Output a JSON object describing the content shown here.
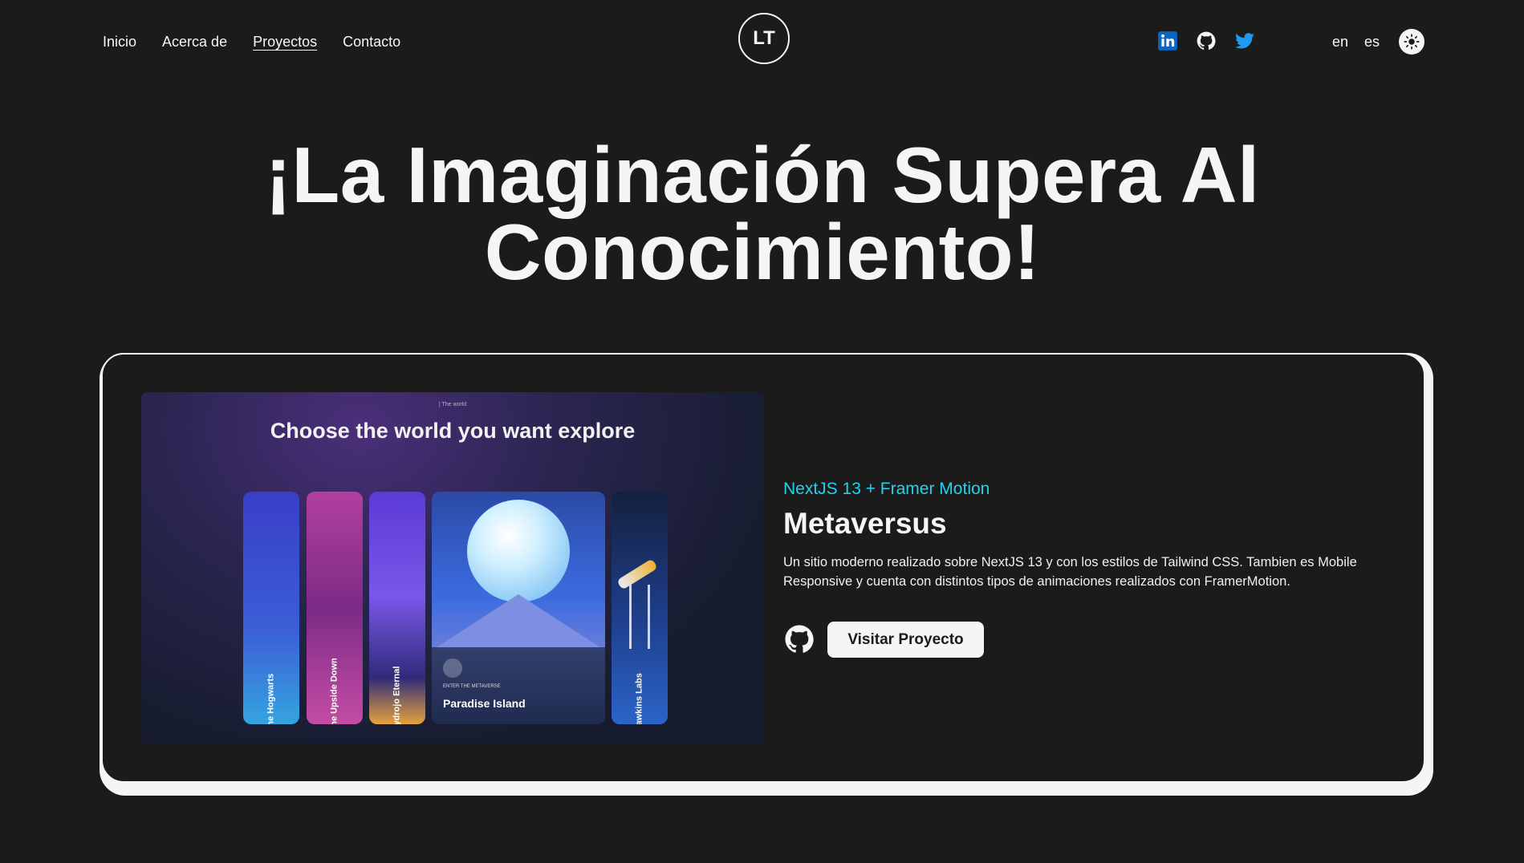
{
  "nav": {
    "items": [
      {
        "label": "Inicio",
        "active": false
      },
      {
        "label": "Acerca de",
        "active": false
      },
      {
        "label": "Proyectos",
        "active": true
      },
      {
        "label": "Contacto",
        "active": false
      }
    ]
  },
  "logo": {
    "text": "LT"
  },
  "social": {
    "icons": [
      "linkedin-icon",
      "github-icon",
      "twitter-icon"
    ],
    "colors": {
      "linkedin": "#0a66c2",
      "github": "#f5f5f5",
      "twitter": "#1d9bf0"
    }
  },
  "lang": {
    "en": "en",
    "es": "es"
  },
  "theme": {
    "icon": "sun-icon"
  },
  "hero": {
    "line1": "¡La Imaginación Supera Al",
    "line2": "Conocimiento!"
  },
  "project": {
    "tech": "NextJS 13 + Framer Motion",
    "title": "Metaversus",
    "description": "Un sitio moderno realizado sobre NextJS 13 y con los estilos de Tailwind CSS. Tambien es Mobile Responsive y cuenta con distintos tipos de animaciones realizados con FramerMotion.",
    "button_label": "Visitar Proyecto",
    "accent": "#22d3ee",
    "screenshot": {
      "eyebrow": "| The world",
      "heading": "Choose the world you want explore",
      "panels": [
        {
          "label": "The Hogwarts"
        },
        {
          "label": "The Upside Down"
        },
        {
          "label": "Hydrojo Eternal"
        },
        {
          "label": "Paradise Island",
          "sub": "ENTER THE METAVERSE"
        },
        {
          "label": "Hawkins Labs"
        }
      ]
    }
  }
}
